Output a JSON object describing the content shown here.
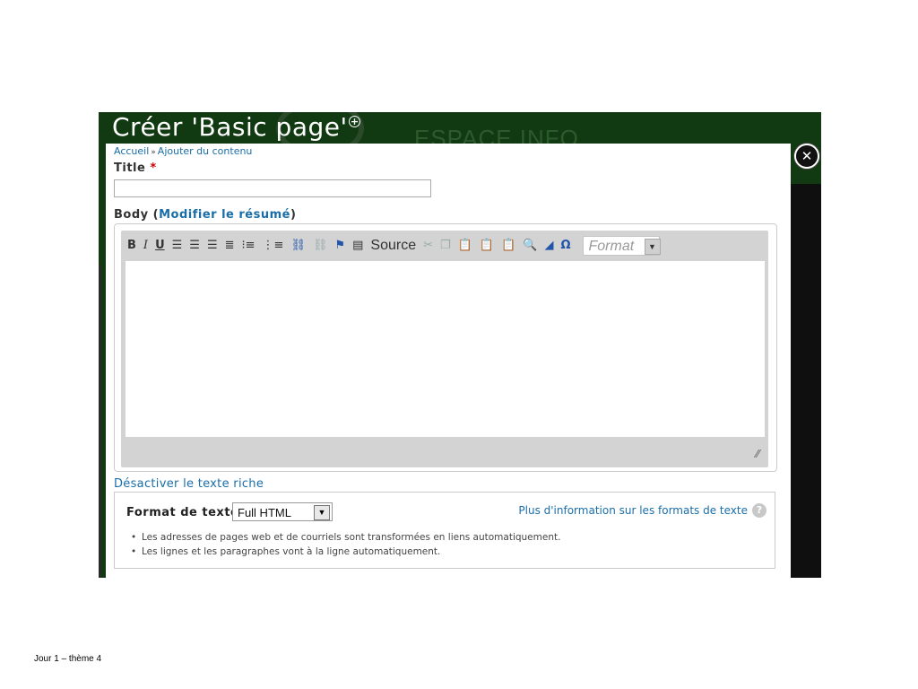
{
  "modal": {
    "title": "Créer 'Basic page'",
    "background_brand": "ESPACE INFO",
    "close_symbol": "✕"
  },
  "breadcrumb": {
    "home": "Accueil",
    "separator": "»",
    "current": "Ajouter du contenu"
  },
  "form": {
    "title_label": "Title",
    "required_marker": "*",
    "title_value": "",
    "body_label_open": "Body (",
    "body_summary_link": "Modifier le résumé",
    "body_label_close": ")"
  },
  "editor": {
    "toolbar": {
      "bold": "B",
      "italic": "I",
      "underline": "U",
      "source_label": "Source",
      "format_placeholder": "Format"
    },
    "content": ""
  },
  "rich_text_toggle": "Désactiver le texte riche",
  "text_format": {
    "label": "Format de texte",
    "selected": "Full HTML",
    "more_info_link": "Plus d'information sur les formats de texte",
    "tips": [
      "Les adresses de pages web et de courriels sont transformées en liens automatiquement.",
      "Les lignes et les paragraphes vont à la ligne automatiquement."
    ]
  },
  "slide_footer": "Jour 1 – thème 4",
  "colors": {
    "window_bg": "#123a12",
    "link": "#1a6ea8",
    "required": "#cc0000"
  },
  "icons": {
    "align_left": "align-left-icon",
    "align_center": "align-center-icon",
    "align_right": "align-right-icon",
    "justify": "justify-icon",
    "bullet_list": "bullet-list-icon",
    "numbered_list": "numbered-list-icon",
    "link": "link-icon",
    "unlink": "unlink-icon",
    "anchor": "anchor-flag-icon",
    "source": "source-icon",
    "cut": "cut-icon",
    "copy": "copy-icon",
    "paste": "paste-icon",
    "paste_text": "paste-text-icon",
    "paste_word": "paste-word-icon",
    "find": "find-icon",
    "remove_format": "eraser-icon",
    "special_char": "omega-icon"
  }
}
